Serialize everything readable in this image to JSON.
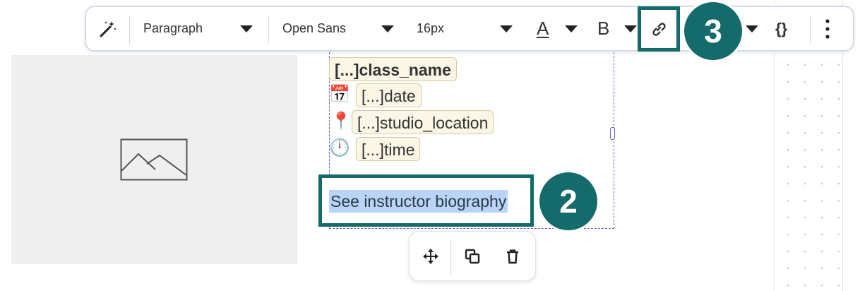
{
  "toolbar": {
    "block_style": "Paragraph",
    "font_family": "Open Sans",
    "font_size": "16px",
    "text_color_label": "A",
    "bold_label": "B",
    "dynamic_content_label": "{}"
  },
  "merge_tags": {
    "class_name": "[...]class_name",
    "date": "[...]date",
    "studio_location": "[...]studio_location",
    "time": "[...]time"
  },
  "emojis": {
    "calendar": "📅",
    "pin": "📍",
    "clock": "🕛"
  },
  "selected_text": "See instructor biography",
  "badges": {
    "step_link": "3",
    "step_text": "2"
  },
  "colors": {
    "accent": "#156b6b",
    "selection": "#b9d4f7",
    "block_outline": "#6a5acd",
    "tag_bg": "#fbf6e6"
  }
}
